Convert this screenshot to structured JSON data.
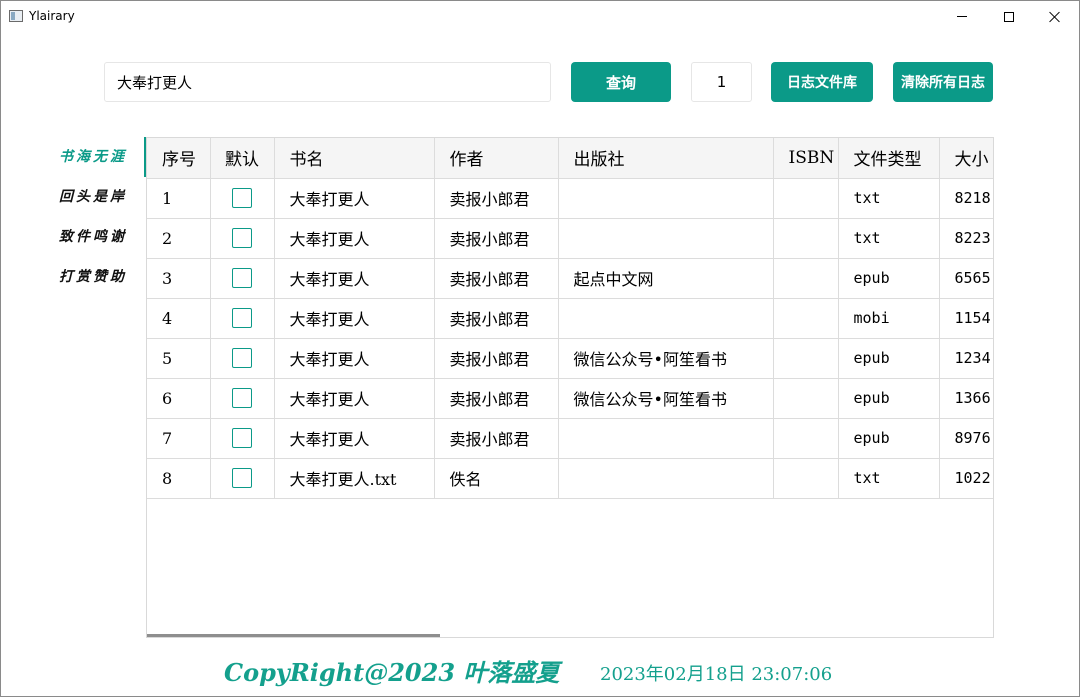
{
  "window": {
    "title": "Ylairary"
  },
  "toolbar": {
    "search_value": "大奉打更人",
    "query_label": "查询",
    "page_value": "1",
    "logs_label": "日志文件库",
    "clear_logs_label": "清除所有日志"
  },
  "sidebar": {
    "items": [
      {
        "label": "书海无涯",
        "active": true
      },
      {
        "label": "回头是岸",
        "active": false
      },
      {
        "label": "致件鸣谢",
        "active": false
      },
      {
        "label": "打赏赞助",
        "active": false
      }
    ]
  },
  "table": {
    "columns": [
      "序号",
      "默认",
      "书名",
      "作者",
      "出版社",
      "ISBN",
      "文件类型",
      "大小"
    ],
    "rows": [
      {
        "index": "1",
        "checked": false,
        "title": "大奉打更人",
        "author": "卖报小郎君",
        "publisher": "",
        "isbn": "",
        "type": "txt",
        "size": "8218"
      },
      {
        "index": "2",
        "checked": false,
        "title": "大奉打更人",
        "author": "卖报小郎君",
        "publisher": "",
        "isbn": "",
        "type": "txt",
        "size": "8223"
      },
      {
        "index": "3",
        "checked": false,
        "title": "大奉打更人",
        "author": "卖报小郎君",
        "publisher": "起点中文网",
        "isbn": "",
        "type": "epub",
        "size": "6565"
      },
      {
        "index": "4",
        "checked": false,
        "title": "大奉打更人",
        "author": "卖报小郎君",
        "publisher": "",
        "isbn": "",
        "type": "mobi",
        "size": "1154"
      },
      {
        "index": "5",
        "checked": false,
        "title": "大奉打更人",
        "author": "卖报小郎君",
        "publisher": "微信公众号•阿笙看书",
        "isbn": "",
        "type": "epub",
        "size": "1234"
      },
      {
        "index": "6",
        "checked": false,
        "title": "大奉打更人",
        "author": "卖报小郎君",
        "publisher": "微信公众号•阿笙看书",
        "isbn": "",
        "type": "epub",
        "size": "1366"
      },
      {
        "index": "7",
        "checked": false,
        "title": "大奉打更人",
        "author": "卖报小郎君",
        "publisher": "",
        "isbn": "",
        "type": "epub",
        "size": "8976"
      },
      {
        "index": "8",
        "checked": false,
        "title": "大奉打更人.txt",
        "author": "佚名",
        "publisher": "",
        "isbn": "",
        "type": "txt",
        "size": "1022"
      }
    ]
  },
  "footer": {
    "copyright": "CopyRight@2023 叶落盛夏",
    "datetime": "2023年02月18日 23:07:06"
  },
  "colors": {
    "accent": "#0b9a88",
    "footer_text": "#14a08d"
  }
}
